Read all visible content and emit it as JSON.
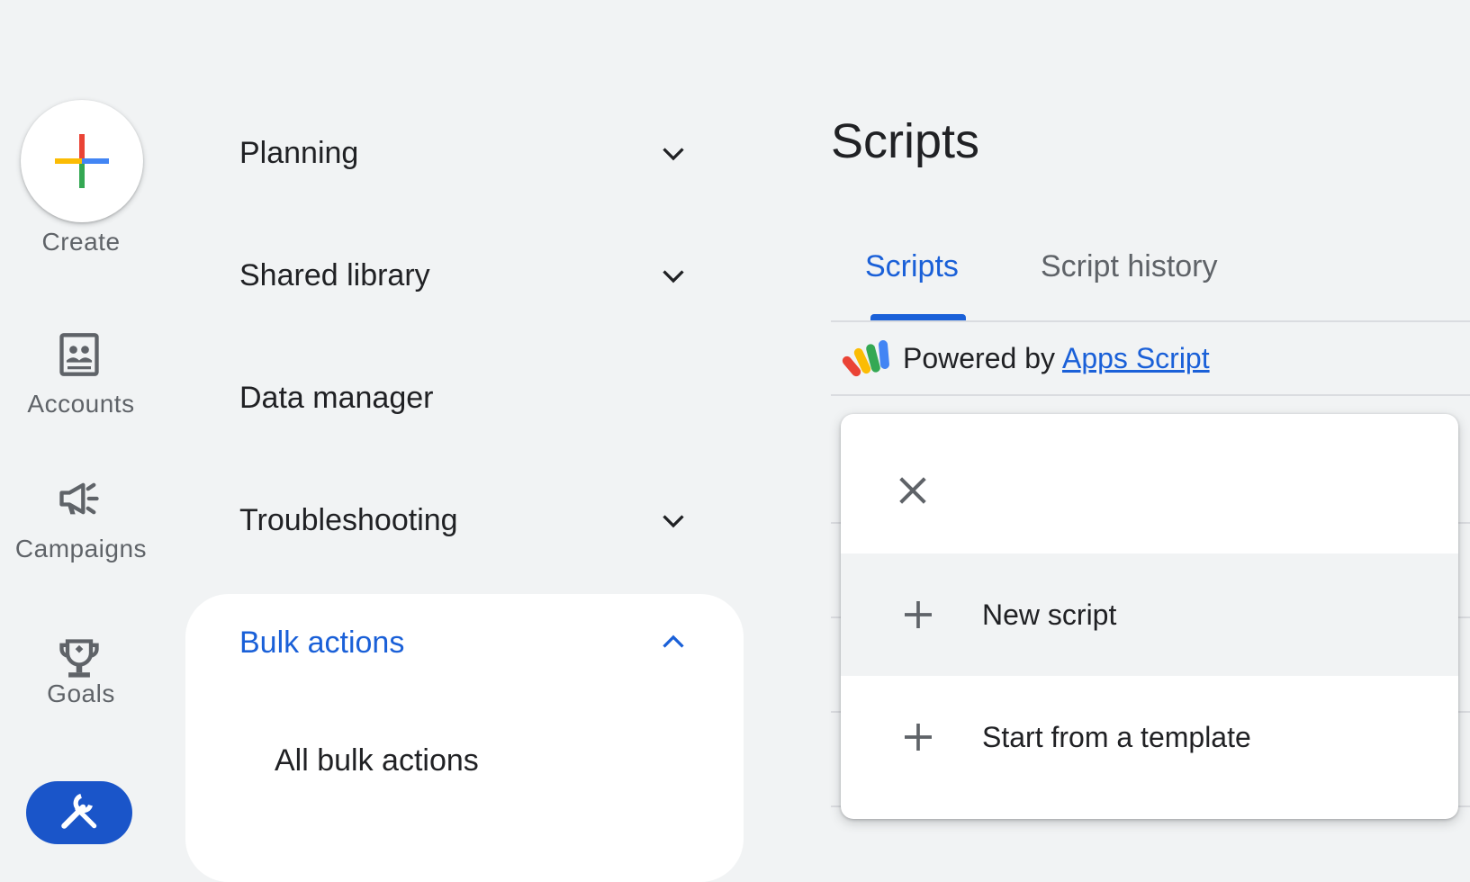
{
  "rail": {
    "create_label": "Create",
    "items": [
      {
        "label": "Accounts",
        "icon": "accounts-icon"
      },
      {
        "label": "Campaigns",
        "icon": "megaphone-icon"
      },
      {
        "label": "Goals",
        "icon": "trophy-icon"
      }
    ],
    "active_icon": "tools-icon"
  },
  "nav": {
    "planning": "Planning",
    "shared_library": "Shared library",
    "data_manager": "Data manager",
    "troubleshooting": "Troubleshooting",
    "bulk_actions": "Bulk actions",
    "all_bulk_actions": "All bulk actions"
  },
  "main": {
    "title": "Scripts",
    "tabs": [
      {
        "label": "Scripts",
        "active": true
      },
      {
        "label": "Script history",
        "active": false
      }
    ],
    "powered_by": "Powered by",
    "apps_script_link": "Apps Script"
  },
  "menu": {
    "items": [
      {
        "label": "New script"
      },
      {
        "label": "Start from a template"
      }
    ]
  },
  "colors": {
    "accent": "#1a60d8",
    "background": "#f1f3f4"
  }
}
